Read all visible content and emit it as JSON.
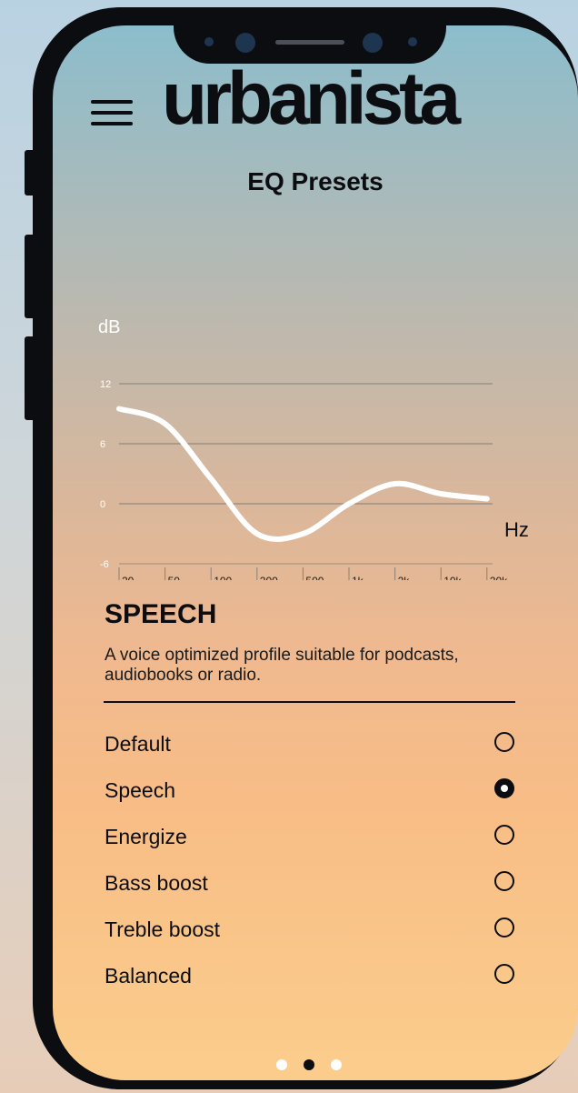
{
  "app": {
    "brand": "urbanista",
    "title": "EQ Presets"
  },
  "icons": {
    "menu": "hamburger-menu-icon"
  },
  "chart_data": {
    "type": "line",
    "ylabel": "dB",
    "xlabel": "Hz",
    "yticks": [
      "12",
      "6",
      "0",
      "-6"
    ],
    "ylim": [
      -6,
      12
    ],
    "xticks": [
      "20",
      "50",
      "100",
      "200",
      "500",
      "1k",
      "2k",
      "10k",
      "20k"
    ],
    "x": [
      "20",
      "50",
      "100",
      "200",
      "500",
      "1k",
      "2k",
      "10k",
      "20k"
    ],
    "series": [
      {
        "values": [
          9.5,
          8,
          2.5,
          -3,
          -3,
          0,
          2,
          1,
          0.5
        ],
        "color": "#ffffff"
      }
    ],
    "grid": true
  },
  "preset": {
    "name": "SPEECH",
    "description": "A voice optimized profile suitable for podcasts, audiobooks or radio."
  },
  "options": [
    {
      "label": "Default",
      "selected": false
    },
    {
      "label": "Speech",
      "selected": true
    },
    {
      "label": "Energize",
      "selected": false
    },
    {
      "label": "Bass boost",
      "selected": false
    },
    {
      "label": "Treble boost",
      "selected": false
    },
    {
      "label": "Balanced",
      "selected": false
    }
  ],
  "pagination": {
    "count": 3,
    "active": 1
  }
}
